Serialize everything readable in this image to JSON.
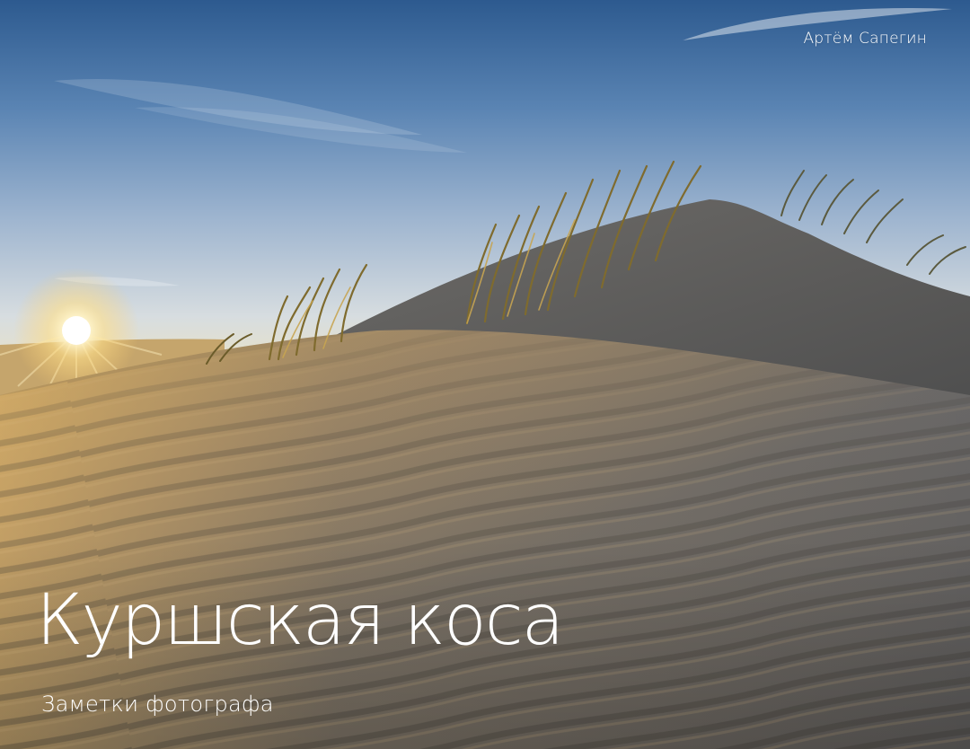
{
  "cover": {
    "author": "Артём Сапегин",
    "title": "Куршская коса",
    "subtitle": "Заметки фотографа"
  },
  "colors": {
    "sky_top": "#2e5d93",
    "sky_horizon": "#e9e3c8",
    "sun": "#fff4c2",
    "sand_light": "#b79a6a",
    "sand_shadow": "#5f5d5c",
    "grass": "#8d7a35",
    "text": "#ffffff"
  }
}
